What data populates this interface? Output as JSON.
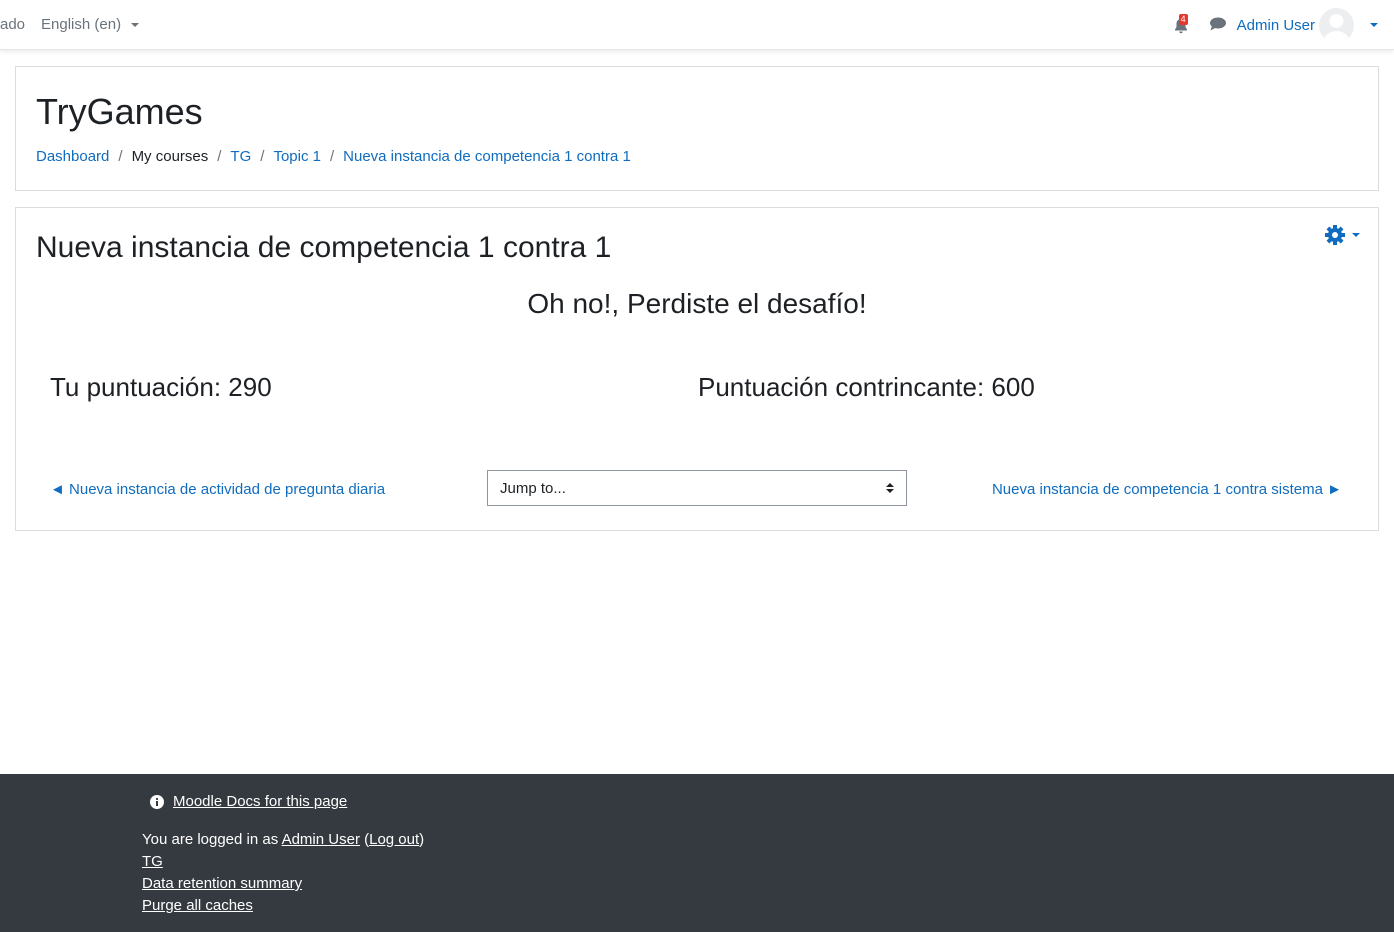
{
  "navbar": {
    "cut_text": "ado",
    "language": "English (en)",
    "notification_count": "4",
    "user_name": "Admin User"
  },
  "header": {
    "site_title": "TryGames",
    "breadcrumb": [
      "Dashboard",
      "My courses",
      "TG",
      "Topic 1",
      "Nueva instancia de competencia 1 contra 1"
    ]
  },
  "main": {
    "page_title": "Nueva instancia de competencia 1 contra 1",
    "result_heading": "Oh no!, Perdiste el desafío!",
    "your_score": "Tu puntuación: 290",
    "opponent_score": "Puntuación contrincante: 600",
    "prev_link": "◄ Nueva instancia de actividad de pregunta diaria",
    "next_link": "Nueva instancia de competencia 1 contra sistema ►",
    "jump_select": "Jump to..."
  },
  "footer": {
    "docs_link": "Moodle Docs for this page",
    "logged_prefix": "You are logged in as ",
    "logged_user": "Admin User",
    "logout_open": " (",
    "logout": "Log out",
    "logout_close": ")",
    "course": "TG",
    "data_retention": "Data retention summary",
    "purge": "Purge all caches"
  },
  "colors": {
    "link": "#0f6cbf",
    "footer_bg": "#343a40",
    "badge": "#e8362c"
  }
}
